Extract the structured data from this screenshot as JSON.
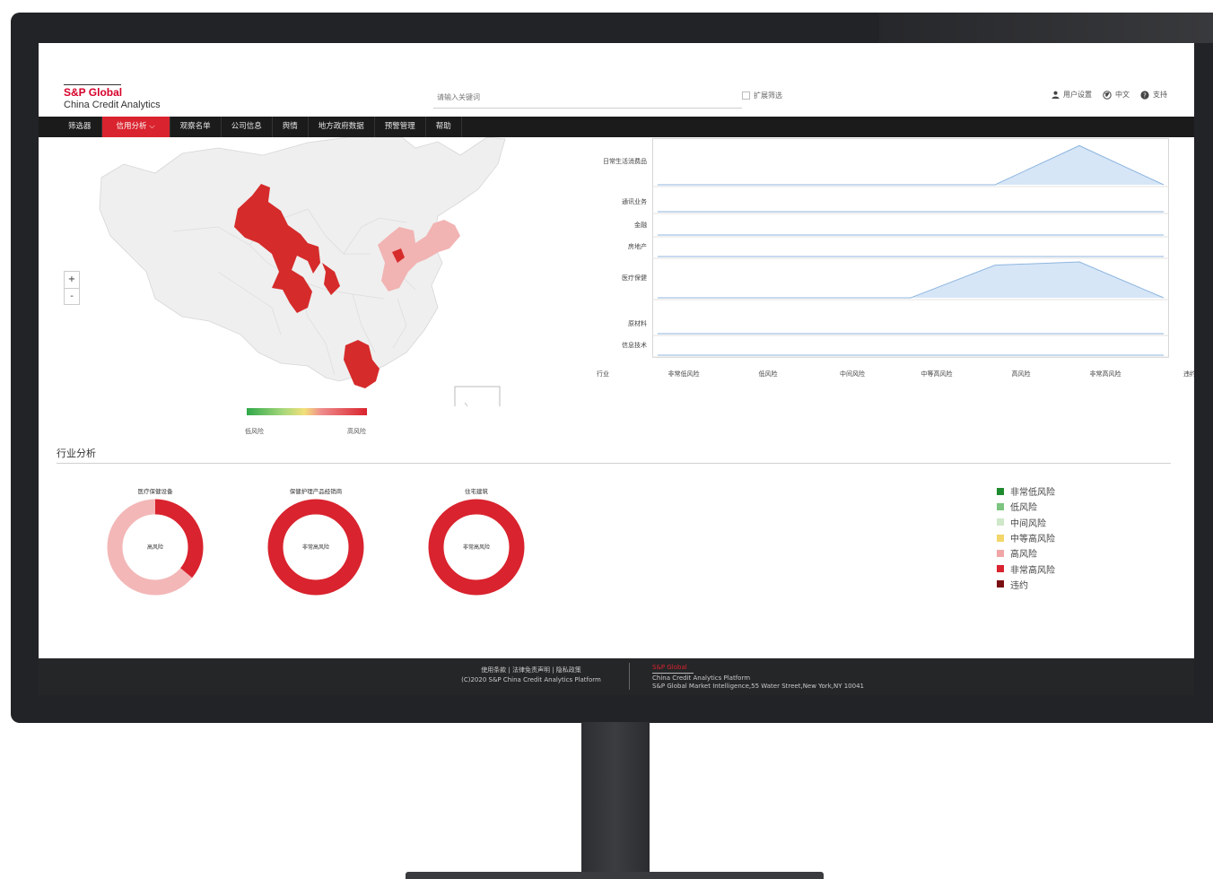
{
  "header": {
    "logo_brand": "S&P Global",
    "logo_sub": "China Credit Analytics",
    "search_placeholder": "请输入关键词",
    "expand_label": "扩展筛选",
    "user_settings": "用户设置",
    "language": "中文",
    "support": "支持"
  },
  "nav": {
    "items": [
      {
        "label": "筛选器",
        "active": false
      },
      {
        "label": "信用分析 ⌵",
        "active": true
      },
      {
        "label": "观察名单",
        "active": false
      },
      {
        "label": "公司信息",
        "active": false
      },
      {
        "label": "舆情",
        "active": false
      },
      {
        "label": "地方政府数据",
        "active": false
      },
      {
        "label": "预警管理",
        "active": false
      },
      {
        "label": "帮助",
        "active": false
      }
    ]
  },
  "map": {
    "zoom_in": "+",
    "zoom_out": "-",
    "legend_low": "低风险",
    "legend_high": "高风险"
  },
  "chart_data": {
    "type": "area",
    "title": "",
    "categories": [
      "非常低风险",
      "低风险",
      "中间风险",
      "中等高风险",
      "高风险",
      "非常高风险",
      "违约"
    ],
    "x_axis_title": "行业",
    "rows": [
      {
        "name": "日常生活消费品",
        "values": [
          0,
          0,
          0,
          0,
          0,
          1,
          0
        ]
      },
      {
        "name": "通讯业务",
        "values": [
          0,
          0,
          0,
          0,
          0,
          0,
          0
        ]
      },
      {
        "name": "金融",
        "values": [
          0,
          0,
          0,
          0,
          0,
          0,
          0
        ]
      },
      {
        "name": "房地产",
        "values": [
          0,
          0,
          0,
          0,
          0,
          0,
          0
        ]
      },
      {
        "name": "医疗保健",
        "values": [
          0,
          0,
          0,
          0,
          1,
          1.1,
          0
        ]
      },
      {
        "name": "原材料",
        "values": [
          0,
          0,
          0,
          0,
          0,
          0,
          0
        ]
      },
      {
        "name": "信息技术",
        "values": [
          0,
          0,
          0,
          0,
          0,
          0,
          0
        ]
      }
    ],
    "fill_color": "#d6e6f7",
    "line_color": "#8fb6df"
  },
  "section": {
    "title": "行业分析"
  },
  "donuts": [
    {
      "title": "医疗保健设备",
      "center": "高风险",
      "segments": [
        {
          "value": 0.36,
          "color": "#d9232e"
        },
        {
          "value": 0.64,
          "color": "#f3b7b7"
        }
      ]
    },
    {
      "title": "保健护理产品经销商",
      "center": "非常高风险",
      "segments": [
        {
          "value": 1.0,
          "color": "#d9232e"
        }
      ]
    },
    {
      "title": "住宅建筑",
      "center": "非常高风险",
      "segments": [
        {
          "value": 1.0,
          "color": "#d9232e"
        }
      ]
    }
  ],
  "risk_legend": [
    {
      "label": "非常低风险",
      "color": "#1e8a2e"
    },
    {
      "label": "低风险",
      "color": "#7cc47f"
    },
    {
      "label": "中间风险",
      "color": "#cfe8c9"
    },
    {
      "label": "中等高风险",
      "color": "#f2d66a"
    },
    {
      "label": "高风险",
      "color": "#f0a6a6"
    },
    {
      "label": "非常高风险",
      "color": "#d9232e"
    },
    {
      "label": "违约",
      "color": "#7a0f12"
    }
  ],
  "footer": {
    "links": "使用条款 | 法律免责声明 | 隐私政策",
    "copyright": "(C)2020 S&P China Credit Analytics Platform",
    "brand": "S&P Global",
    "platform": "China Credit Analytics Platform",
    "address": "S&P Global Market Intelligence,55 Water Street,New York,NY 10041"
  },
  "colors": {
    "accent": "#d9232e",
    "nav_bg": "#1b1b1c",
    "footer_bg": "#252628",
    "map_default": "#efefef",
    "map_high": "#d62b2b",
    "map_medium": "#f2b3b3"
  }
}
